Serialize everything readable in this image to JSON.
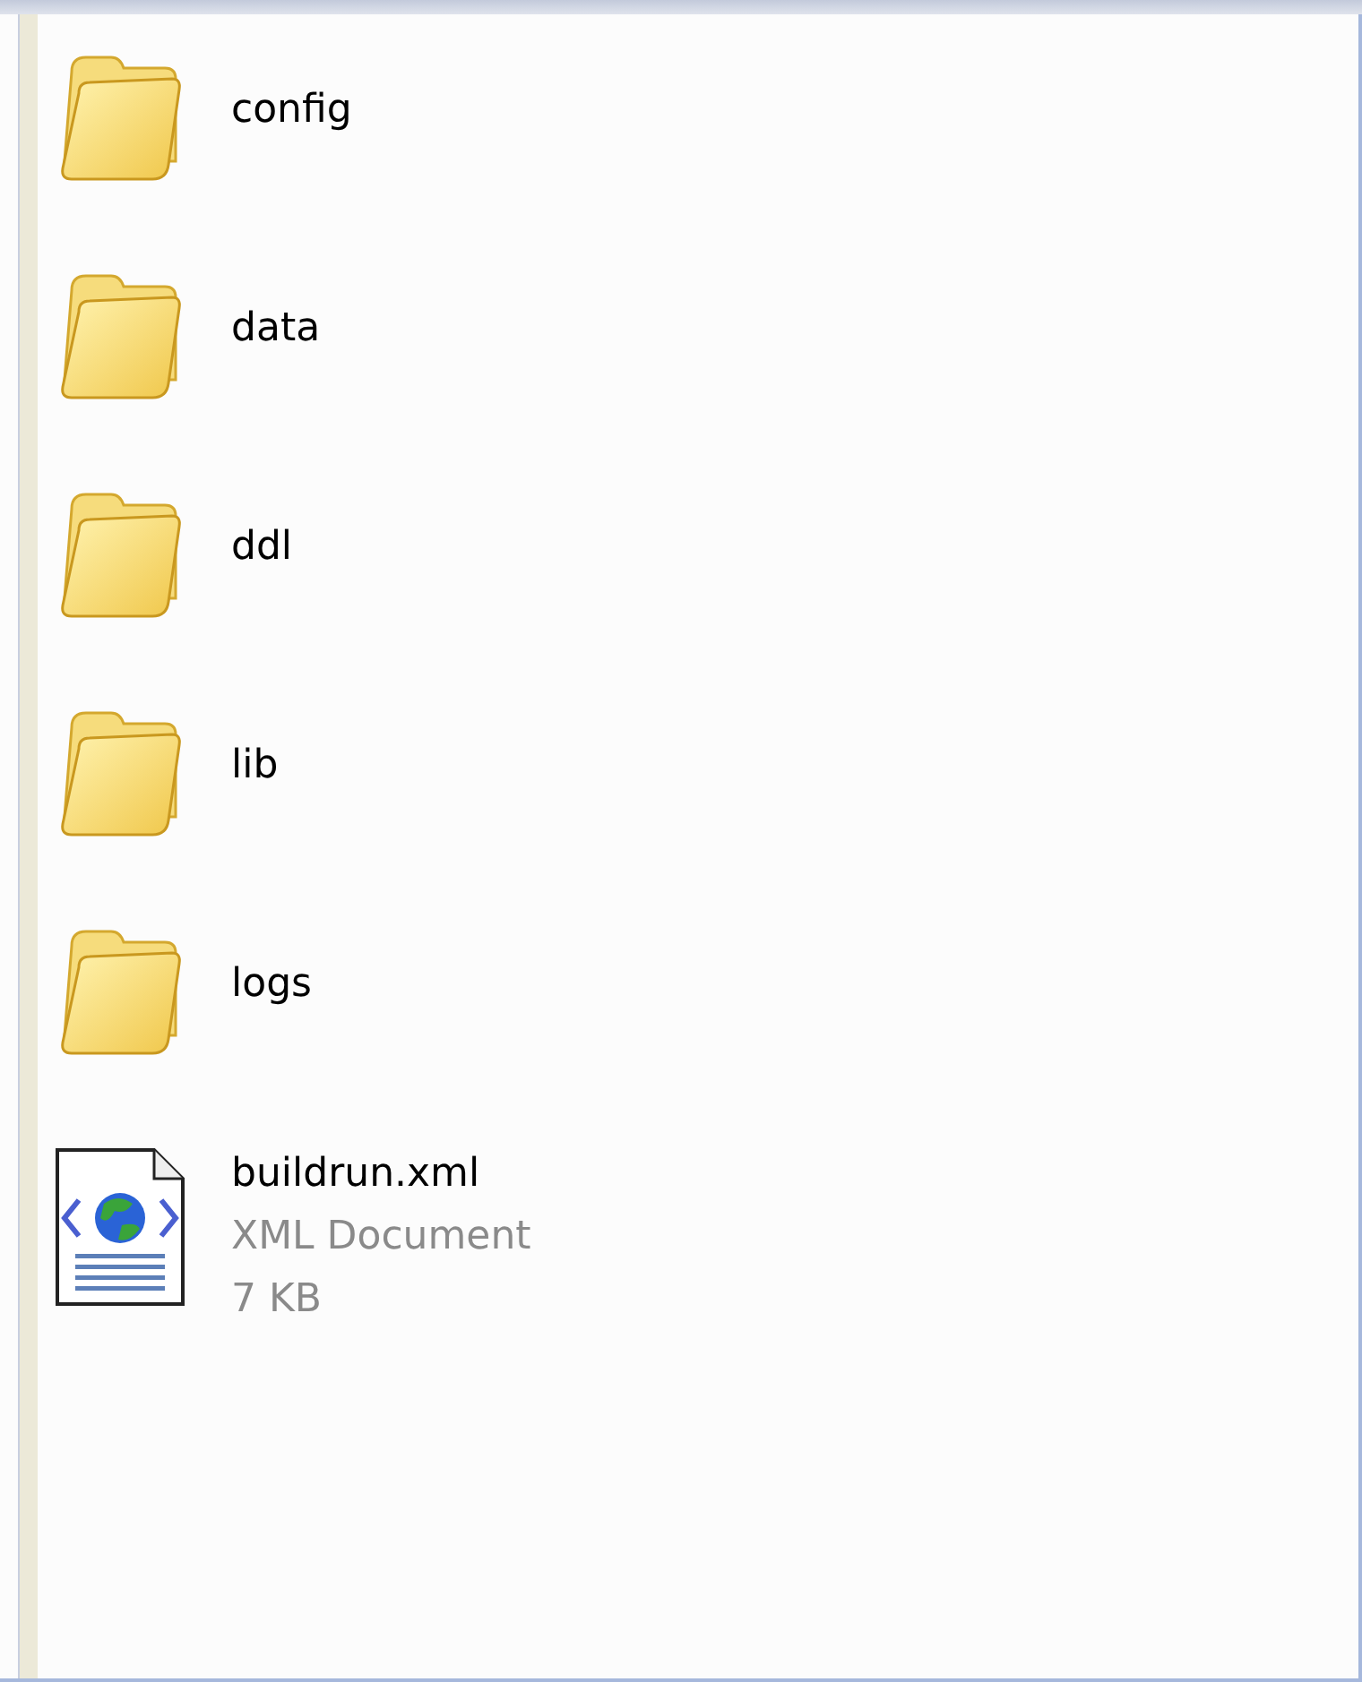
{
  "items": [
    {
      "kind": "folder",
      "name": "config"
    },
    {
      "kind": "folder",
      "name": "data"
    },
    {
      "kind": "folder",
      "name": "ddl"
    },
    {
      "kind": "folder",
      "name": "lib"
    },
    {
      "kind": "folder",
      "name": "logs"
    },
    {
      "kind": "file",
      "name": "buildrun.xml",
      "type": "XML Document",
      "size": "7 KB"
    }
  ]
}
